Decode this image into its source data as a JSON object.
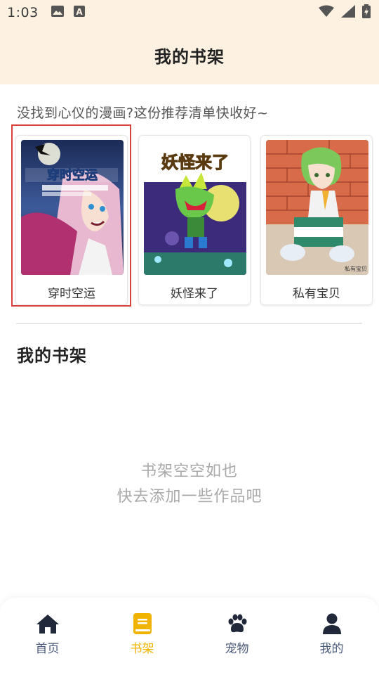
{
  "status_bar": {
    "time": "1:03",
    "icons": [
      "image-icon",
      "text-a-icon",
      "wifi-icon",
      "signal-icon",
      "battery-icon"
    ]
  },
  "header": {
    "title": "我的书架"
  },
  "recommend": {
    "text": "没找到心仪的漫画?这份推荐清单快收好~",
    "items": [
      {
        "title": "穿时空运",
        "cover_text": "穿时空运"
      },
      {
        "title": "妖怪来了",
        "cover_text": "妖怪来了"
      },
      {
        "title": "私有宝贝",
        "cover_text": "私有宝贝"
      }
    ]
  },
  "shelf": {
    "heading": "我的书架",
    "empty_line1": "书架空空如也",
    "empty_line2": "快去添加一些作品吧"
  },
  "bottom_nav": {
    "items": [
      {
        "label": "首页",
        "icon": "home-icon",
        "active": false
      },
      {
        "label": "书架",
        "icon": "book-icon",
        "active": true
      },
      {
        "label": "宠物",
        "icon": "paw-icon",
        "active": false
      },
      {
        "label": "我的",
        "icon": "user-icon",
        "active": false
      }
    ]
  },
  "colors": {
    "header_bg": "#fdf1e2",
    "accent": "#f0b400",
    "nav_inactive": "#4a5a79",
    "highlight": "#d9413b"
  }
}
